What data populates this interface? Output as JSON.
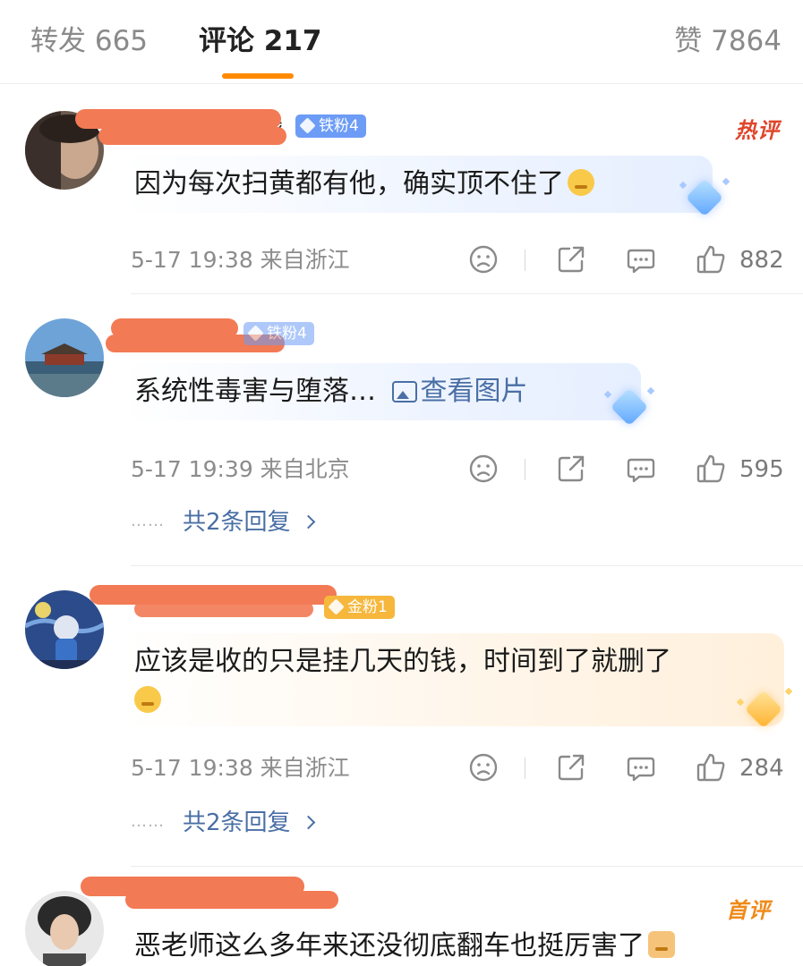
{
  "tabs": {
    "repost": "转发 665",
    "comment": "评论 217",
    "like": "赞 7864"
  },
  "comments": [
    {
      "username_visible": "钱",
      "badge": "铁粉4",
      "tag": "热评",
      "text": "因为每次扫黄都有他，确实顶不住了",
      "meta": "5-17 19:38  来自浙江",
      "likes": "882"
    },
    {
      "username_visible": "",
      "badge": "铁粉4",
      "text": "系统性毒害与堕落…",
      "image_link": "查看图片",
      "meta": "5-17 19:39  来自北京",
      "likes": "595",
      "replies": "共2条回复"
    },
    {
      "username_visible": "",
      "badge": "金粉1",
      "text": "应该是收的只是挂几天的钱，时间到了就删了",
      "meta": "5-17 19:38  来自浙江",
      "likes": "284",
      "replies": "共2条回复"
    },
    {
      "username_visible": "",
      "tag": "首评",
      "text": "恶老师这么多年来还没彻底翻车也挺厉害了"
    }
  ],
  "reply_dots": "……",
  "colors": {
    "accent": "#ff8a00",
    "link": "#4a6fa5",
    "redaction": "#f27a54",
    "hot_tag": "#e0452b",
    "first_tag": "#f08a1a"
  },
  "icons": [
    "dislike-icon",
    "share-icon",
    "reply-icon",
    "like-icon",
    "image-icon",
    "chevron-right-icon"
  ]
}
